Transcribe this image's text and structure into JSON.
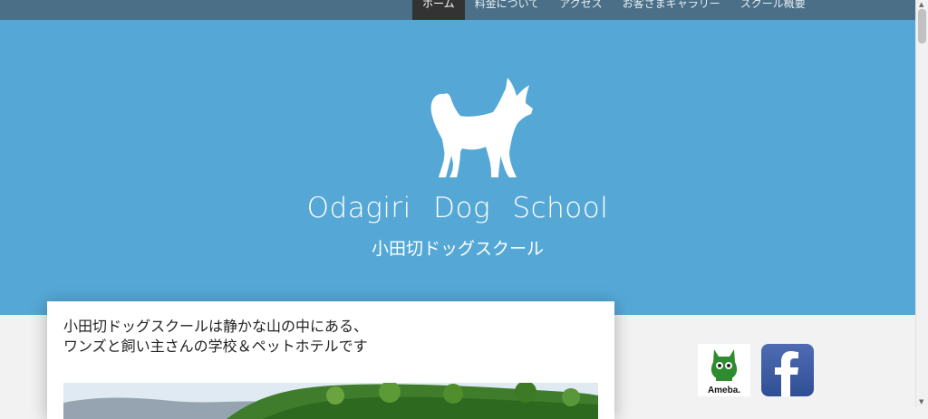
{
  "nav": {
    "items": [
      {
        "label": "ホーム",
        "active": true
      },
      {
        "label": "料金について"
      },
      {
        "label": "アクセス"
      },
      {
        "label": "お客さまギャラリー"
      },
      {
        "label": "スクール概要"
      }
    ]
  },
  "hero": {
    "brand_en": "Odagiri Dog School",
    "brand_jp": "小田切ドッグスクール",
    "logo_icon": "dog-silhouette-icon",
    "background_color": "#55a8d6"
  },
  "intro": {
    "line1": "小田切ドッグスクールは静かな山の中にある、",
    "line2": "ワンズと飼い主さんの学校＆ペットホテルです"
  },
  "social": {
    "ameba_label": "Ameba.",
    "facebook_icon": "facebook-icon"
  },
  "colors": {
    "nav": "#4a6f87",
    "nav_active": "#333333"
  }
}
